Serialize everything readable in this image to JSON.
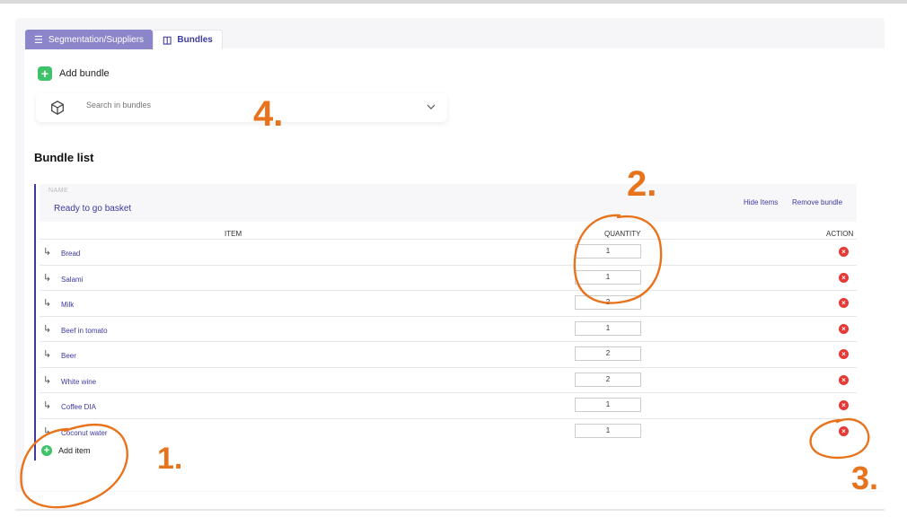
{
  "tabs": [
    {
      "label": "Segmentation/Suppliers",
      "icon": "list-icon",
      "active": false
    },
    {
      "label": "Bundles",
      "icon": "cube-icon",
      "active": true
    }
  ],
  "add_bundle_label": "Add bundle",
  "search": {
    "placeholder": "Search in bundles"
  },
  "section_title": "Bundle list",
  "bundle": {
    "name_label": "NAME",
    "name": "Ready to go basket",
    "hide_items": "Hide Items",
    "remove_bundle": "Remove bundle",
    "columns": {
      "item": "ITEM",
      "quantity": "QUANTITY",
      "action": "ACTION"
    },
    "items": [
      {
        "name": "Bread",
        "quantity": "1"
      },
      {
        "name": "Salami",
        "quantity": "1"
      },
      {
        "name": "Milk",
        "quantity": "2"
      },
      {
        "name": "Beef in tomato",
        "quantity": "1"
      },
      {
        "name": "Beer",
        "quantity": "2"
      },
      {
        "name": "White wine",
        "quantity": "2"
      },
      {
        "name": "Coffee DIA",
        "quantity": "1"
      },
      {
        "name": "Coconut water",
        "quantity": "1"
      }
    ],
    "add_item_label": "Add item"
  },
  "annotations": {
    "n1": "1.",
    "n2": "2.",
    "n3": "3.",
    "n4": "4."
  },
  "colors": {
    "accent": "#3d3aa0",
    "tab_inactive": "#8b86c9",
    "add": "#3ec36b",
    "delete": "#e53935",
    "annotation": "#e8731d"
  }
}
